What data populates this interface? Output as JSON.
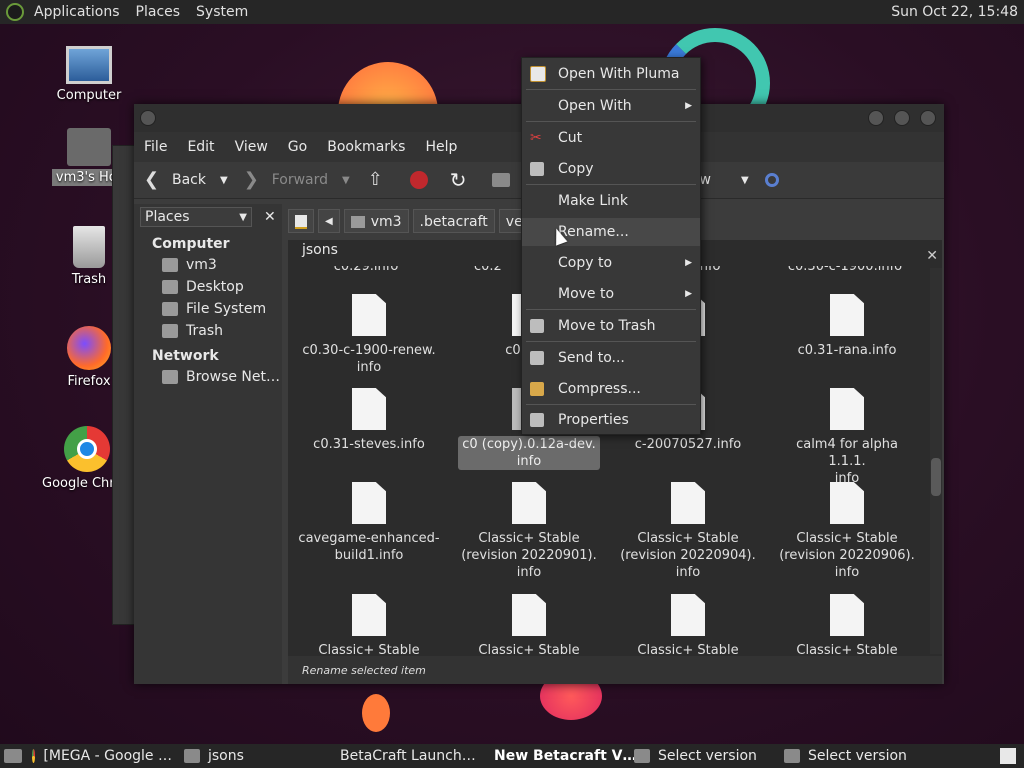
{
  "top_panel": {
    "menus": [
      "Applications",
      "Places",
      "System"
    ],
    "clock": "Sun Oct 22, 15:48"
  },
  "desktop_icons": {
    "computer": "Computer",
    "home": "vm3's Hor",
    "trash": "Trash",
    "firefox": "Firefox",
    "chrome": "Google Chr"
  },
  "window": {
    "menu": [
      "File",
      "Edit",
      "View",
      "Go",
      "Bookmarks",
      "Help"
    ],
    "toolbar": {
      "back": "Back",
      "forward": "Forward",
      "view": "View"
    },
    "sidebar": {
      "combo": "Places",
      "computer_header": "Computer",
      "computer_items": [
        "vm3",
        "Desktop",
        "File System",
        "Trash"
      ],
      "network_header": "Network",
      "network_items": [
        "Browse Net…"
      ]
    },
    "path": [
      "vm3",
      ".betacraft",
      "versic"
    ],
    "tab": "jsons",
    "partial_top_row": [
      "c0.29.info",
      "c0.2",
      ".info",
      "c0.30-c-1900.info"
    ],
    "files": [
      "c0.30-c-1900-renew.\ninfo",
      "c0.30-s",
      "info",
      "c0.31-rana.info",
      "c0.31-steves.info",
      "c0 (copy).0.12a-dev.\ninfo",
      "c-20070527.info",
      "calm4 for alpha 1.1.1.\ninfo",
      "cavegame-enhanced-\nbuild1.info",
      "Classic+ Stable\n(revision 20220901).\ninfo",
      "Classic+ Stable\n(revision 20220904).\ninfo",
      "Classic+ Stable\n(revision 20220906).\ninfo",
      "Classic+ Stable",
      "Classic+ Stable",
      "Classic+ Stable",
      "Classic+ Stable"
    ],
    "status": "Rename selected item"
  },
  "context_menu": {
    "open_with_pluma": "Open With Pluma",
    "open_with": "Open With",
    "cut": "Cut",
    "copy": "Copy",
    "make_link": "Make Link",
    "rename": "Rename...",
    "copy_to": "Copy to",
    "move_to": "Move to",
    "move_to_trash": "Move to Trash",
    "send_to": "Send to...",
    "compress": "Compress...",
    "properties": "Properties"
  },
  "taskbar": {
    "items": [
      "[MEGA - Google …",
      "jsons",
      "BetaCraft Launch…",
      "New Betacraft V…",
      "Select version",
      "Select version"
    ]
  },
  "colors": {
    "panel": "#262626",
    "window": "#3c3c3c",
    "menu_highlight": "#484848"
  }
}
